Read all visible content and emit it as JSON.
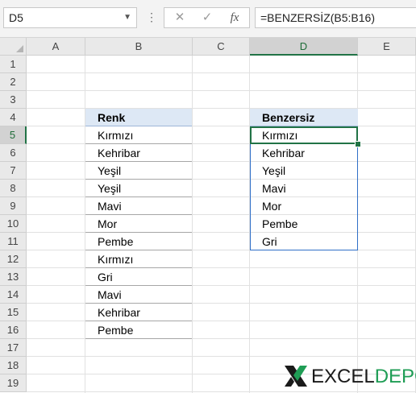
{
  "name_box": {
    "value": "D5",
    "dropdown_icon": "chevron-down-icon"
  },
  "formula_bar": {
    "cancel_icon": "close-icon",
    "enter_icon": "check-icon",
    "fx_label": "fx",
    "formula": "=BENZERSİZ(B5:B16)"
  },
  "grid": {
    "columns": [
      "A",
      "B",
      "C",
      "D",
      "E"
    ],
    "selected_column": "D",
    "rows": [
      "1",
      "2",
      "3",
      "4",
      "5",
      "6",
      "7",
      "8",
      "9",
      "10",
      "11",
      "12",
      "13",
      "14",
      "15",
      "16",
      "17",
      "18",
      "19"
    ],
    "selected_row": "5"
  },
  "source_table": {
    "header": "Renk",
    "items": [
      "Kırmızı",
      "Kehribar",
      "Yeşil",
      "Yeşil",
      "Mavi",
      "Mor",
      "Pembe",
      "Kırmızı",
      "Gri",
      "Mavi",
      "Kehribar",
      "Pembe"
    ]
  },
  "result_table": {
    "header": "Benzersiz",
    "items": [
      "Kırmızı",
      "Kehribar",
      "Yeşil",
      "Mavi",
      "Mor",
      "Pembe",
      "Gri"
    ]
  },
  "logo": {
    "part1": "EXCEL",
    "part2": "DEPO",
    "color1": "#1a1a1a",
    "color2": "#1f9d55"
  },
  "colors": {
    "accent": "#217346",
    "header_fill": "#dde8f5",
    "spill_border": "#2f6fc7"
  }
}
